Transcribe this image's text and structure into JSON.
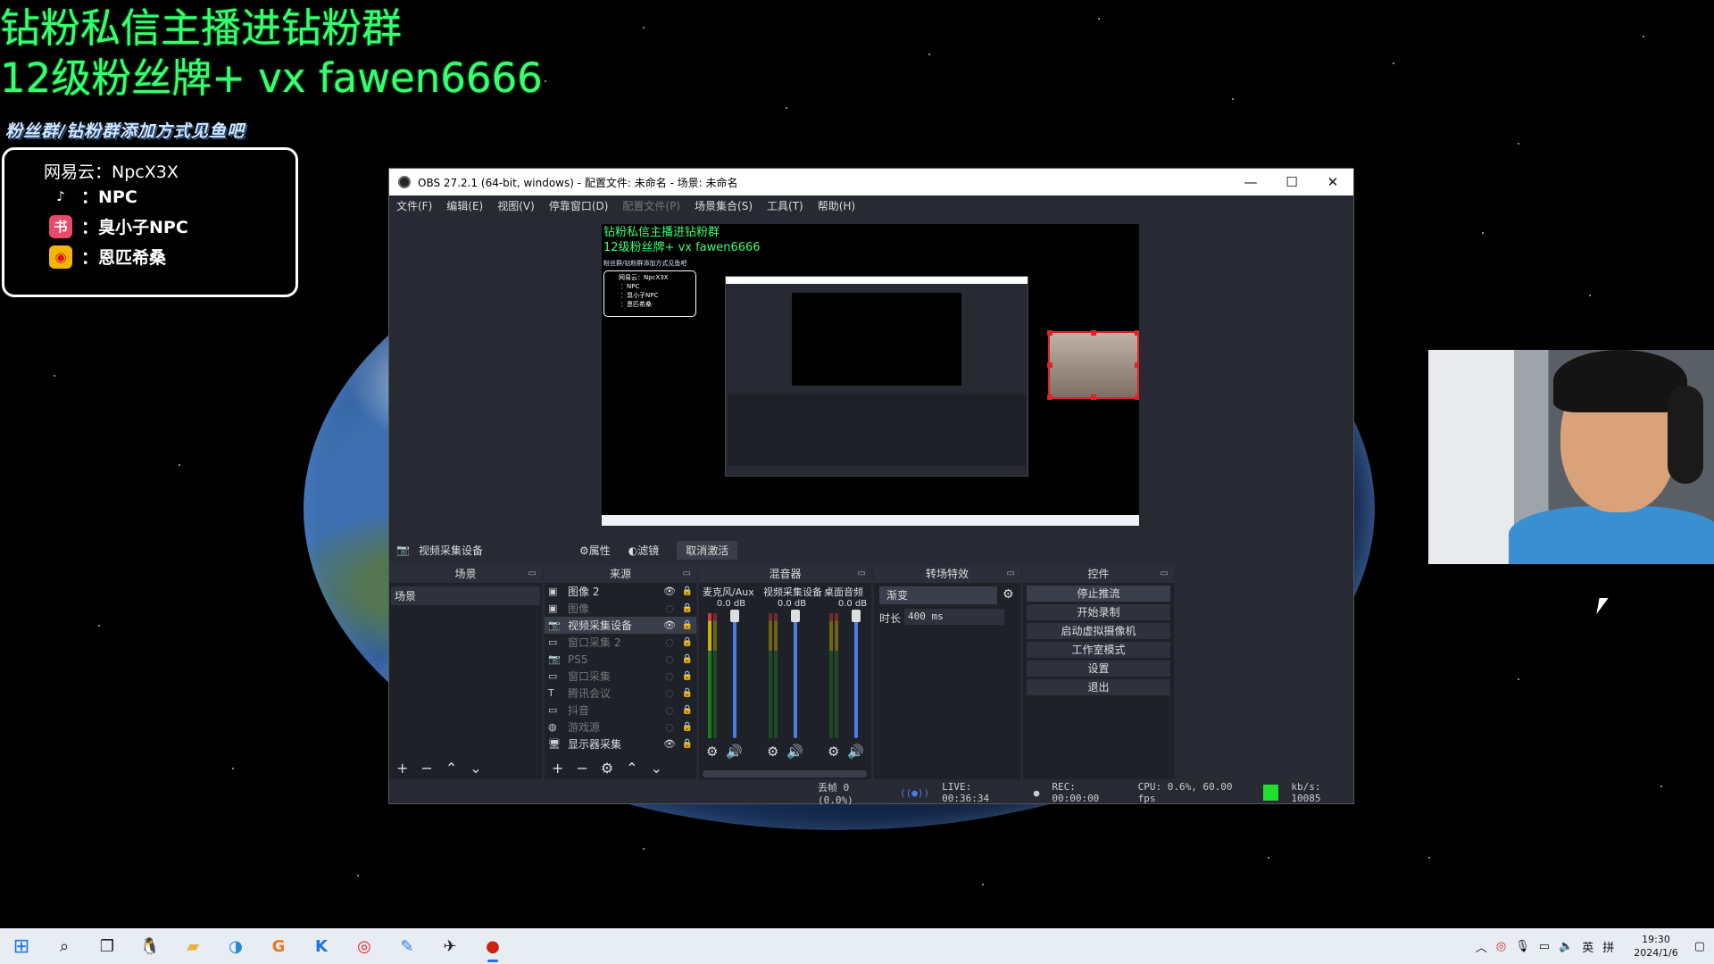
{
  "overlay": {
    "title_line1": "钻粉私信主播进钻粉群",
    "title_line2": "12级粉丝牌+ vx fawen6666",
    "subtitle": "粉丝群/钻粉群添加方式见鱼吧",
    "social": {
      "netease": "网易云：NpcX3X",
      "douyin": "：NPC",
      "xiaohongshu": "：臭小子NPC",
      "weibo": "：恩匹希桑"
    }
  },
  "obs": {
    "title": "OBS 27.2.1 (64-bit, windows) - 配置文件: 未命名 - 场景: 未命名",
    "window_buttons": [
      "—",
      "☐",
      "✕"
    ],
    "menu": [
      "文件(F)",
      "编辑(E)",
      "视图(V)",
      "停靠窗口(D)",
      "配置文件(P)",
      "场景集合(S)",
      "工具(T)",
      "帮助(H)"
    ],
    "preview": {
      "line1": "钻粉私信主播进钻粉群",
      "line2": "12级粉丝牌+ vx fawen6666",
      "line3": "粉丝群/钻粉群添加方式见鱼吧",
      "box_lines": [
        "网易云：NpcX3X",
        "：NPC",
        "：臭小子NPC",
        "：恩匹希桑"
      ]
    },
    "source_bar": {
      "selected_source": "视频采集设备",
      "properties": "属性",
      "filters": "滤镜",
      "deactivate": "取消激活"
    },
    "scenes": {
      "header": "场景",
      "items": [
        "场景"
      ]
    },
    "sources": {
      "header": "来源",
      "items": [
        {
          "name": "图像 2",
          "icon": "image-icon",
          "visible": true
        },
        {
          "name": "图像",
          "icon": "image-icon",
          "visible": false
        },
        {
          "name": "视频采集设备",
          "icon": "camera-icon",
          "visible": true
        },
        {
          "name": "窗口采集 2",
          "icon": "window-icon",
          "visible": false
        },
        {
          "name": "PS5",
          "icon": "camera-icon",
          "visible": false
        },
        {
          "name": "窗口采集",
          "icon": "window-icon",
          "visible": false
        },
        {
          "name": "腾讯会议",
          "icon": "text-icon",
          "visible": false
        },
        {
          "name": "抖音",
          "icon": "window-icon",
          "visible": false
        },
        {
          "name": "游戏源",
          "icon": "gamepad-icon",
          "visible": false
        },
        {
          "name": "显示器采集",
          "icon": "monitor-icon",
          "visible": true
        }
      ]
    },
    "mixer": {
      "header": "混音器",
      "channels": [
        {
          "name": "麦克风/Aux",
          "db": "0.0 dB"
        },
        {
          "name": "视频采集设备",
          "db": "0.0 dB"
        },
        {
          "name": "桌面音频",
          "db": "0.0 dB"
        }
      ],
      "scale": [
        "0",
        "-5",
        "-10",
        "-15",
        "-20",
        "-25",
        "-30",
        "-35",
        "-40",
        "-45",
        "-50",
        "-55",
        "-60"
      ]
    },
    "transitions": {
      "header": "转场特效",
      "selected": "渐变",
      "duration_label": "时长",
      "duration_value": "400 ms"
    },
    "controls": {
      "header": "控件",
      "buttons": [
        "停止推流",
        "开始录制",
        "启动虚拟摄像机",
        "工作室模式",
        "设置",
        "退出"
      ]
    },
    "status": {
      "dropped": "丢帧 0 (0.0%)",
      "live": "LIVE: 00:36:34",
      "rec": "REC: 00:00:00",
      "cpu": "CPU: 0.6%, 60.00 fps",
      "kbps": "kb/s: 10085",
      "kb_color": "#1fe02e"
    }
  },
  "taskbar": {
    "icons": [
      "windows-start-icon",
      "search-icon",
      "task-view-icon",
      "qq-icon",
      "file-explorer-icon",
      "edge-icon",
      "app-g-icon",
      "kugou-icon",
      "netease-music-icon",
      "app-feather-icon",
      "app-plane-icon",
      "obs-icon"
    ],
    "tray": {
      "ime": "英",
      "ime2": "拼",
      "time": "19:30",
      "date": "2024/1/6"
    }
  },
  "colors": {
    "overlay_green": "#39ff72",
    "obs_bg": "#272a33",
    "selection_red": "#e0222a"
  }
}
